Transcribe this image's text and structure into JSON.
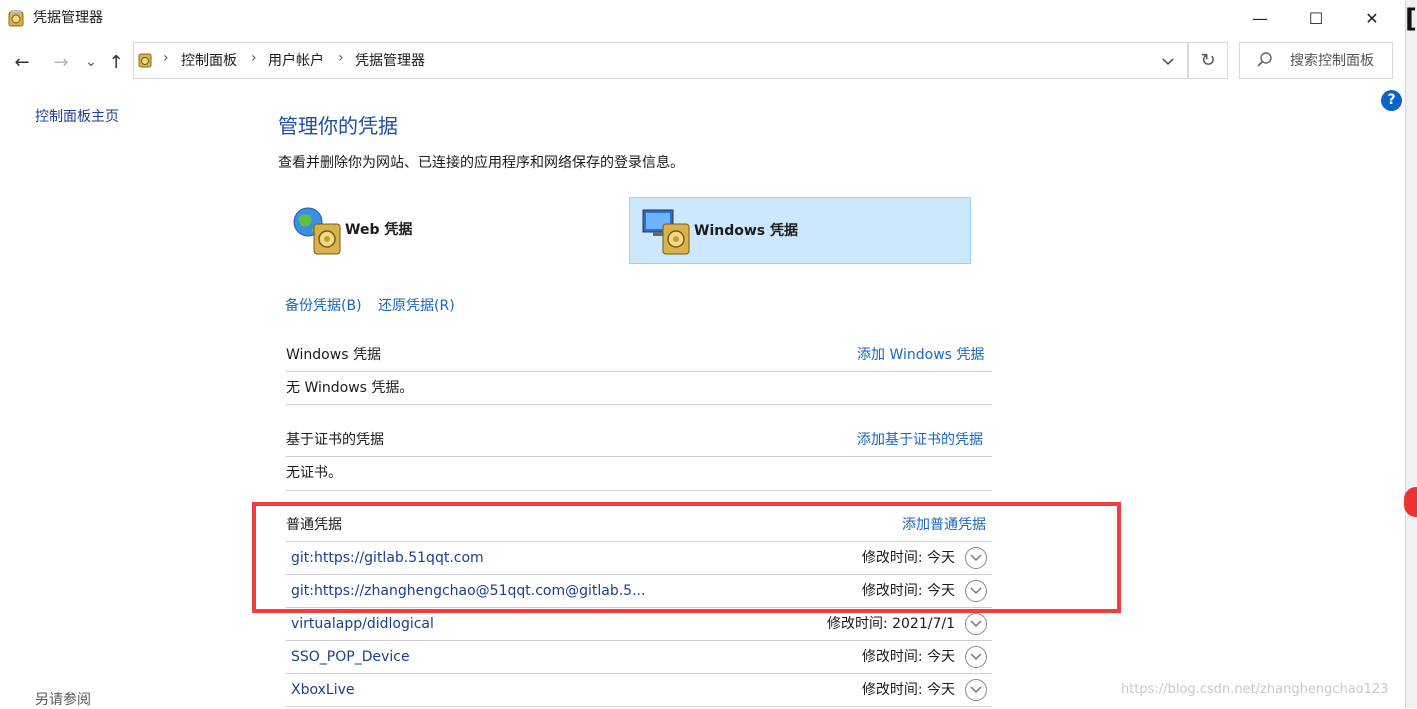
{
  "window": {
    "title": "凭据管理器",
    "minimize_glyph": "—",
    "maximize_glyph": "☐",
    "close_glyph": "✕"
  },
  "nav": {
    "back_glyph": "←",
    "forward_glyph": "→",
    "recent_glyph": "⌄",
    "up_glyph": "↑",
    "breadcrumb": [
      "控制面板",
      "用户帐户",
      "凭据管理器"
    ],
    "separator": "›",
    "refresh_glyph": "↻",
    "search_placeholder": "搜索控制面板"
  },
  "left_pane": {
    "home_link": "控制面板主页",
    "see_also": "另请参阅"
  },
  "main": {
    "title": "管理你的凭据",
    "description": "查看并删除你为网站、已连接的应用程序和网络保存的登录信息。",
    "tiles": [
      {
        "label": "Web 凭据",
        "icon": "web-credentials-icon",
        "selected": false
      },
      {
        "label": "Windows 凭据",
        "icon": "windows-credentials-icon",
        "selected": true
      }
    ],
    "backup_link": "备份凭据(B)",
    "restore_link": "还原凭据(R)",
    "sections": {
      "windows": {
        "title": "Windows 凭据",
        "add_link": "添加 Windows 凭据",
        "empty_text": "无 Windows 凭据。"
      },
      "certificate": {
        "title": "基于证书的凭据",
        "add_link": "添加基于证书的凭据",
        "empty_text": "无证书。"
      },
      "generic": {
        "title": "普通凭据",
        "add_link": "添加普通凭据",
        "items": [
          {
            "name": "git:https://gitlab.51qqt.com",
            "modified": "修改时间:  今天"
          },
          {
            "name": "git:https://zhanghengchao@51qqt.com@gitlab.5...",
            "modified": "修改时间:  今天"
          },
          {
            "name": "virtualapp/didlogical",
            "modified": "修改时间:  2021/7/1"
          },
          {
            "name": "SSO_POP_Device",
            "modified": "修改时间:  今天"
          },
          {
            "name": "XboxLive",
            "modified": "修改时间:  今天"
          }
        ]
      }
    }
  },
  "annotation": {
    "highlight_color": "#ee3e3e"
  },
  "colors": {
    "link": "#1a65c0",
    "title": "#1e4ea1",
    "selected_tile": "#cce8ff",
    "help": "#0b63c7"
  },
  "edge": {
    "help_glyph": "?",
    "bracket_glyph": "["
  },
  "watermark": "https://blog.csdn.net/zhanghengchao123"
}
